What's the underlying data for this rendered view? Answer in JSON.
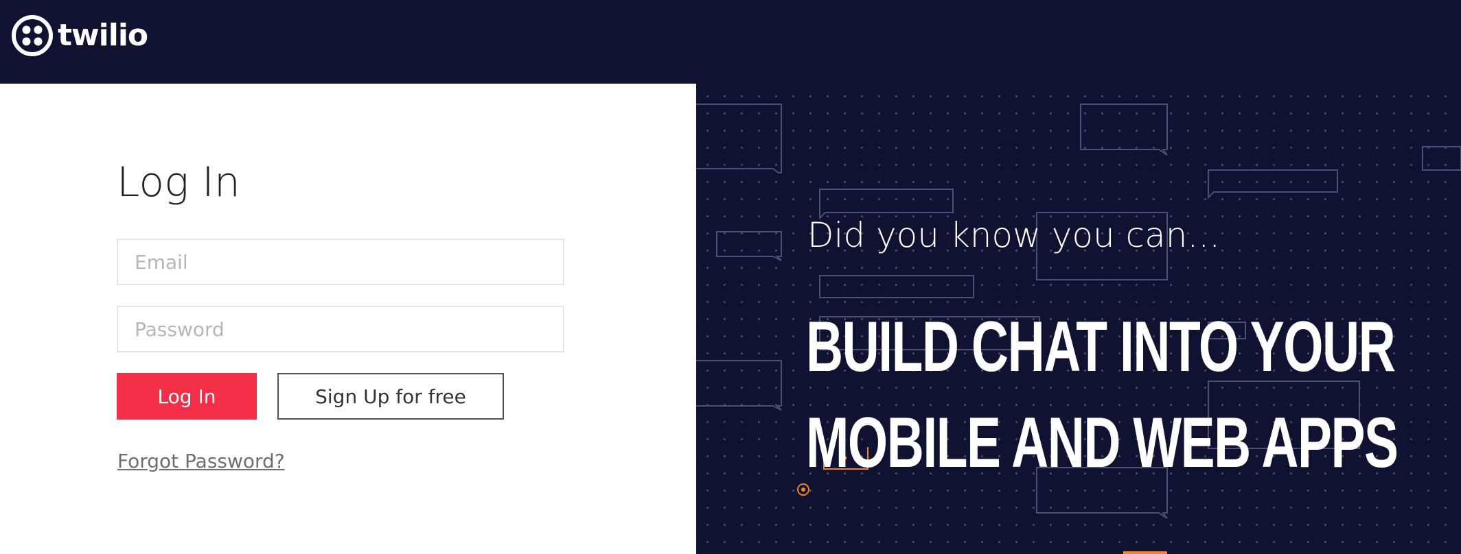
{
  "brand": {
    "name": "twilio",
    "logo_icon": "twilio-logo-icon",
    "background_color": "#0f1331"
  },
  "login": {
    "title": "Log In",
    "email_placeholder": "Email",
    "password_placeholder": "Password",
    "login_button_label": "Log In",
    "signup_button_label": "Sign Up for free",
    "forgot_link": "Forgot Password?",
    "accent_color": "#f22f46"
  },
  "promo": {
    "kicker": "Did you know you can...",
    "headline": "BUILD CHAT INTO YOUR MOBILE AND WEB APPS",
    "decoration": "chat-bubbles-pattern",
    "highlight_color": "#f5821f"
  }
}
